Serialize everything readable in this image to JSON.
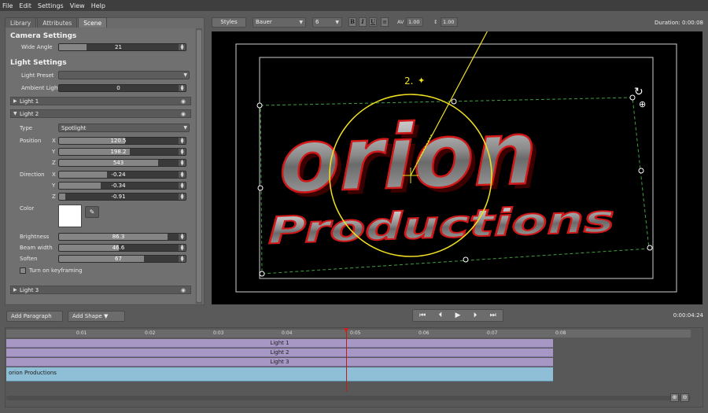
{
  "menu": [
    "File",
    "Edit",
    "Settings",
    "View",
    "Help"
  ],
  "tabs": [
    "Library",
    "Attributes",
    "Scene"
  ],
  "camera": {
    "heading": "Camera Settings",
    "wide_angle_label": "Wide Angle",
    "wide_angle": "21"
  },
  "light_settings": {
    "heading": "Light Settings",
    "preset_label": "Light Preset",
    "preset_value": "",
    "ambient_label": "Ambient Light",
    "ambient_value": "0",
    "lights": [
      "Light 1",
      "Light 2",
      "Light 3"
    ]
  },
  "light2": {
    "type_label": "Type",
    "type_value": "Spotlight",
    "position_label": "Position",
    "pos_x": "120.5",
    "pos_y": "198.2",
    "pos_z": "543",
    "direction_label": "Direction",
    "dir_x": "-0.24",
    "dir_y": "-0.34",
    "dir_z": "-0.91",
    "color_label": "Color",
    "color_value": "#ffffff",
    "brightness_label": "Brightness",
    "brightness": "86.3",
    "beam_label": "Beam width",
    "beam": "46.6",
    "soften_label": "Soften",
    "soften": "67",
    "keyframing_label": "Turn on keyframing"
  },
  "axis_labels": [
    "X",
    "Y",
    "Z"
  ],
  "toolbar": {
    "styles_label": "Styles",
    "font_value": "Bauer",
    "size_value": "6",
    "bold": "B",
    "italic": "I",
    "underline": "U",
    "kerning_label": "AV",
    "kerning_value": "1.00",
    "leading_value": "1.00",
    "duration": "Duration: 0:00:08"
  },
  "preview": {
    "title_text": "orion",
    "subtitle_text": "Productions",
    "light_marker": "2."
  },
  "transport": {
    "timecode": "0:00:04:24"
  },
  "actions": {
    "add_paragraph": "Add Paragraph",
    "add_shape": "Add Shape"
  },
  "timeline": {
    "ticks": [
      "0:01",
      "0:02",
      "0:03",
      "0:04",
      "0:05",
      "0:06",
      "0:07",
      "0:08"
    ],
    "tracks": [
      "Light 1",
      "Light 2",
      "Light 3"
    ],
    "text_track": "orion Productions"
  }
}
